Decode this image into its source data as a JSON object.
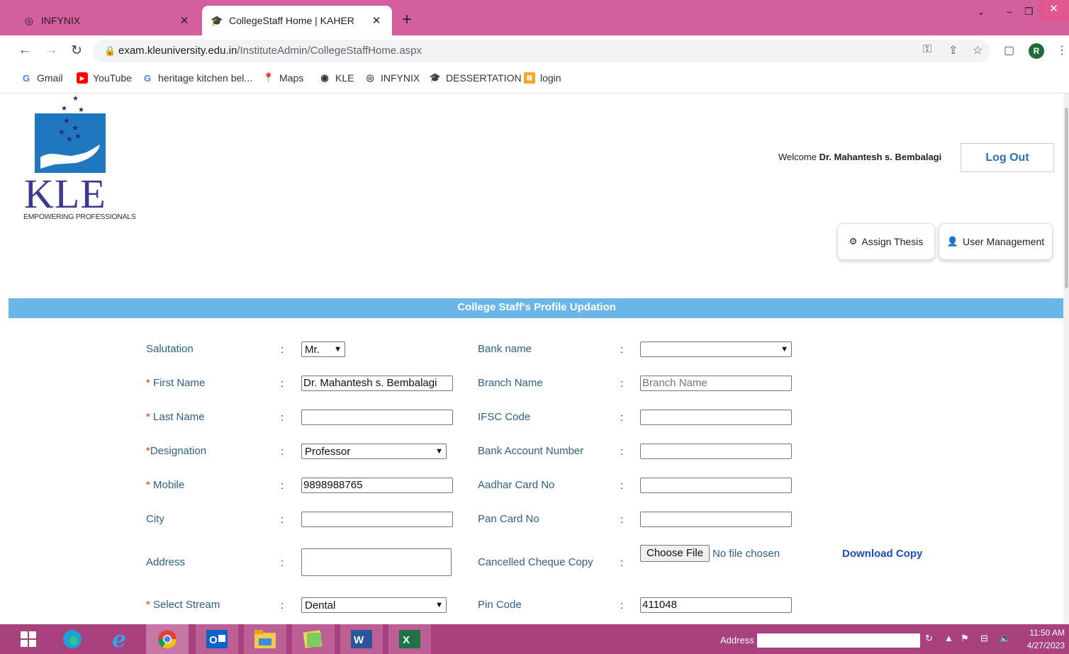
{
  "browser": {
    "tabs": [
      {
        "title": "INFYNIX",
        "active": false
      },
      {
        "title": "CollegeStaff Home | KAHER",
        "active": true
      }
    ],
    "url_host": "exam.kleuniversity.edu.in",
    "url_path": "/InstituteAdmin/CollegeStaffHome.aspx",
    "profile_initial": "R",
    "bookmarks": [
      "Gmail",
      "YouTube",
      "heritage kitchen bel...",
      "Maps",
      "KLE",
      "INFYNIX",
      "DESSERTATION",
      "login"
    ]
  },
  "header": {
    "logo_text": "KLE",
    "logo_tagline": "EMPOWERING PROFESSIONALS",
    "welcome_prefix": "Welcome ",
    "welcome_name": "Dr. Mahantesh s. Bembalagi",
    "logout_label": "Log Out",
    "assign_thesis_label": "Assign Thesis",
    "user_management_label": "User Management"
  },
  "section_title": "College Staff's Profile Updation",
  "form": {
    "colon": ":",
    "required_mark": "*",
    "salutation": {
      "label": "Salutation",
      "value": "Mr."
    },
    "first_name": {
      "label": " First Name",
      "value": "Dr. Mahantesh s. Bembalagi"
    },
    "last_name": {
      "label": " Last Name",
      "value": ""
    },
    "designation": {
      "label": "Designation",
      "value": "Professor"
    },
    "mobile": {
      "label": " Mobile",
      "value": "9898988765"
    },
    "city": {
      "label": "City",
      "value": ""
    },
    "address": {
      "label": "Address",
      "value": ""
    },
    "stream": {
      "label": " Select Stream",
      "value": "Dental"
    },
    "bank_name": {
      "label": "Bank name",
      "value": ""
    },
    "branch_name": {
      "label": "Branch Name",
      "placeholder": "Branch Name"
    },
    "ifsc": {
      "label": "IFSC Code",
      "value": ""
    },
    "account": {
      "label": "Bank Account Number",
      "value": ""
    },
    "aadhar": {
      "label": "Aadhar Card No",
      "value": ""
    },
    "pan": {
      "label": "Pan Card No",
      "value": ""
    },
    "cheque": {
      "label": "Cancelled Cheque Copy",
      "button": "Choose File",
      "status": "No file chosen",
      "download": "Download Copy"
    },
    "pincode": {
      "label": "Pin Code",
      "value": "411048"
    }
  },
  "taskbar": {
    "address_label": "Address",
    "time": "11:50 AM",
    "date": "4/27/2023"
  },
  "colors": {
    "tab_strip": "#d45f9e",
    "section_bar": "#6bb6e8",
    "label_text": "#2d5f8b",
    "taskbar": "#a8417e"
  }
}
